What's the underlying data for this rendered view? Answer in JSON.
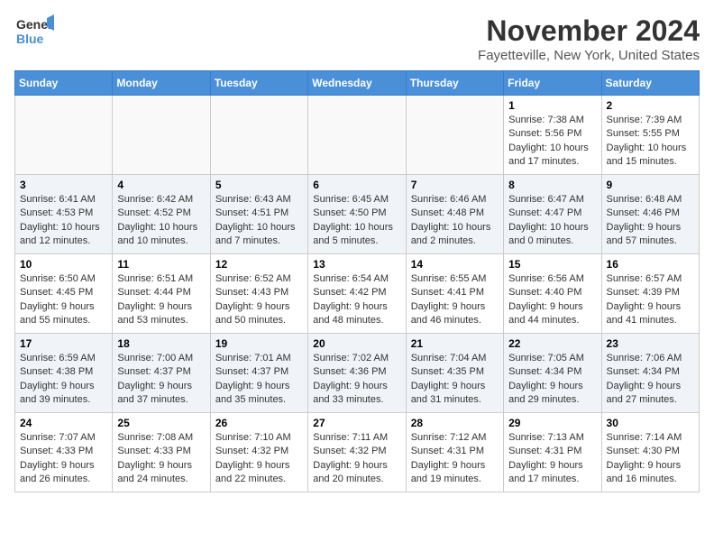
{
  "header": {
    "logo_line1": "General",
    "logo_line2": "Blue",
    "month": "November 2024",
    "location": "Fayetteville, New York, United States"
  },
  "weekdays": [
    "Sunday",
    "Monday",
    "Tuesday",
    "Wednesday",
    "Thursday",
    "Friday",
    "Saturday"
  ],
  "weeks": [
    [
      {
        "day": "",
        "info": ""
      },
      {
        "day": "",
        "info": ""
      },
      {
        "day": "",
        "info": ""
      },
      {
        "day": "",
        "info": ""
      },
      {
        "day": "",
        "info": ""
      },
      {
        "day": "1",
        "info": "Sunrise: 7:38 AM\nSunset: 5:56 PM\nDaylight: 10 hours\nand 17 minutes."
      },
      {
        "day": "2",
        "info": "Sunrise: 7:39 AM\nSunset: 5:55 PM\nDaylight: 10 hours\nand 15 minutes."
      }
    ],
    [
      {
        "day": "3",
        "info": "Sunrise: 6:41 AM\nSunset: 4:53 PM\nDaylight: 10 hours\nand 12 minutes."
      },
      {
        "day": "4",
        "info": "Sunrise: 6:42 AM\nSunset: 4:52 PM\nDaylight: 10 hours\nand 10 minutes."
      },
      {
        "day": "5",
        "info": "Sunrise: 6:43 AM\nSunset: 4:51 PM\nDaylight: 10 hours\nand 7 minutes."
      },
      {
        "day": "6",
        "info": "Sunrise: 6:45 AM\nSunset: 4:50 PM\nDaylight: 10 hours\nand 5 minutes."
      },
      {
        "day": "7",
        "info": "Sunrise: 6:46 AM\nSunset: 4:48 PM\nDaylight: 10 hours\nand 2 minutes."
      },
      {
        "day": "8",
        "info": "Sunrise: 6:47 AM\nSunset: 4:47 PM\nDaylight: 10 hours\nand 0 minutes."
      },
      {
        "day": "9",
        "info": "Sunrise: 6:48 AM\nSunset: 4:46 PM\nDaylight: 9 hours\nand 57 minutes."
      }
    ],
    [
      {
        "day": "10",
        "info": "Sunrise: 6:50 AM\nSunset: 4:45 PM\nDaylight: 9 hours\nand 55 minutes."
      },
      {
        "day": "11",
        "info": "Sunrise: 6:51 AM\nSunset: 4:44 PM\nDaylight: 9 hours\nand 53 minutes."
      },
      {
        "day": "12",
        "info": "Sunrise: 6:52 AM\nSunset: 4:43 PM\nDaylight: 9 hours\nand 50 minutes."
      },
      {
        "day": "13",
        "info": "Sunrise: 6:54 AM\nSunset: 4:42 PM\nDaylight: 9 hours\nand 48 minutes."
      },
      {
        "day": "14",
        "info": "Sunrise: 6:55 AM\nSunset: 4:41 PM\nDaylight: 9 hours\nand 46 minutes."
      },
      {
        "day": "15",
        "info": "Sunrise: 6:56 AM\nSunset: 4:40 PM\nDaylight: 9 hours\nand 44 minutes."
      },
      {
        "day": "16",
        "info": "Sunrise: 6:57 AM\nSunset: 4:39 PM\nDaylight: 9 hours\nand 41 minutes."
      }
    ],
    [
      {
        "day": "17",
        "info": "Sunrise: 6:59 AM\nSunset: 4:38 PM\nDaylight: 9 hours\nand 39 minutes."
      },
      {
        "day": "18",
        "info": "Sunrise: 7:00 AM\nSunset: 4:37 PM\nDaylight: 9 hours\nand 37 minutes."
      },
      {
        "day": "19",
        "info": "Sunrise: 7:01 AM\nSunset: 4:37 PM\nDaylight: 9 hours\nand 35 minutes."
      },
      {
        "day": "20",
        "info": "Sunrise: 7:02 AM\nSunset: 4:36 PM\nDaylight: 9 hours\nand 33 minutes."
      },
      {
        "day": "21",
        "info": "Sunrise: 7:04 AM\nSunset: 4:35 PM\nDaylight: 9 hours\nand 31 minutes."
      },
      {
        "day": "22",
        "info": "Sunrise: 7:05 AM\nSunset: 4:34 PM\nDaylight: 9 hours\nand 29 minutes."
      },
      {
        "day": "23",
        "info": "Sunrise: 7:06 AM\nSunset: 4:34 PM\nDaylight: 9 hours\nand 27 minutes."
      }
    ],
    [
      {
        "day": "24",
        "info": "Sunrise: 7:07 AM\nSunset: 4:33 PM\nDaylight: 9 hours\nand 26 minutes."
      },
      {
        "day": "25",
        "info": "Sunrise: 7:08 AM\nSunset: 4:33 PM\nDaylight: 9 hours\nand 24 minutes."
      },
      {
        "day": "26",
        "info": "Sunrise: 7:10 AM\nSunset: 4:32 PM\nDaylight: 9 hours\nand 22 minutes."
      },
      {
        "day": "27",
        "info": "Sunrise: 7:11 AM\nSunset: 4:32 PM\nDaylight: 9 hours\nand 20 minutes."
      },
      {
        "day": "28",
        "info": "Sunrise: 7:12 AM\nSunset: 4:31 PM\nDaylight: 9 hours\nand 19 minutes."
      },
      {
        "day": "29",
        "info": "Sunrise: 7:13 AM\nSunset: 4:31 PM\nDaylight: 9 hours\nand 17 minutes."
      },
      {
        "day": "30",
        "info": "Sunrise: 7:14 AM\nSunset: 4:30 PM\nDaylight: 9 hours\nand 16 minutes."
      }
    ]
  ]
}
